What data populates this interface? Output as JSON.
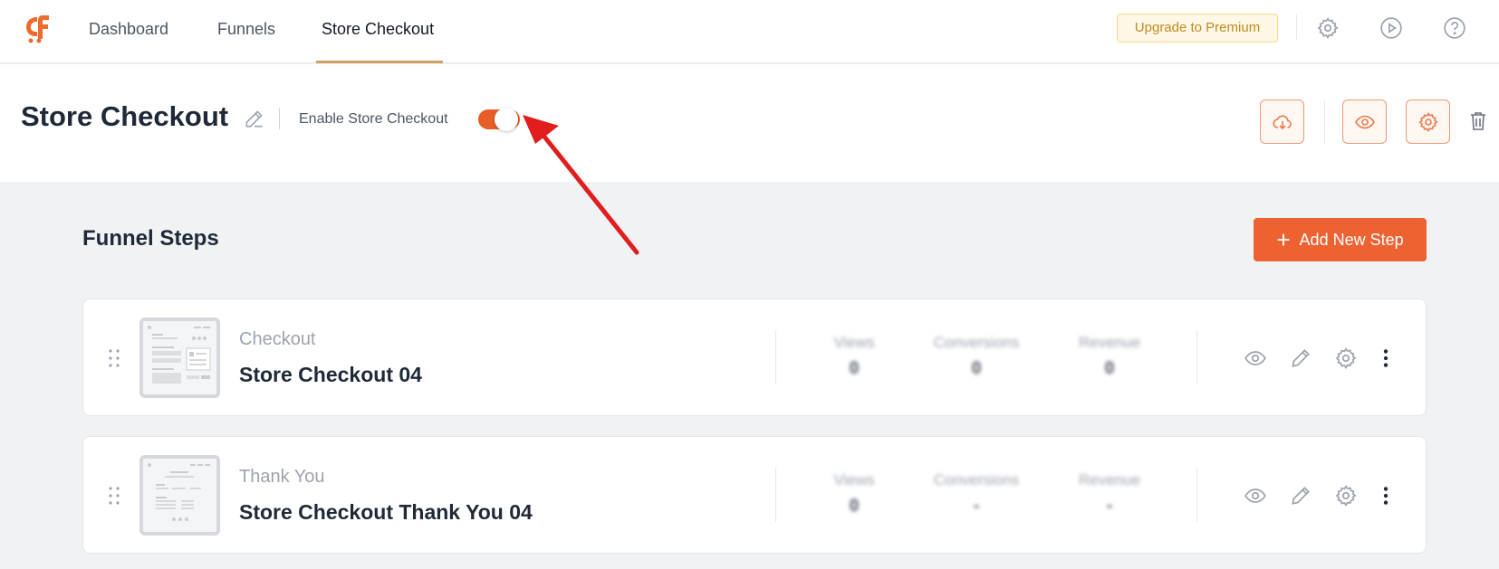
{
  "nav": {
    "links": [
      "Dashboard",
      "Funnels",
      "Store Checkout"
    ],
    "active_index": 2,
    "upgrade_label": "Upgrade to Premium"
  },
  "header": {
    "title": "Store Checkout",
    "enable_label": "Enable Store Checkout",
    "enabled": true
  },
  "section": {
    "title": "Funnel Steps",
    "add_button_label": "Add New Step"
  },
  "steps": [
    {
      "type": "Checkout",
      "name": "Store Checkout 04",
      "stats": [
        {
          "label": "Views",
          "value": "0"
        },
        {
          "label": "Conversions",
          "value": "0"
        },
        {
          "label": "Revenue",
          "value": "0"
        }
      ]
    },
    {
      "type": "Thank You",
      "name": "Store Checkout Thank You 04",
      "stats": [
        {
          "label": "Views",
          "value": "0"
        },
        {
          "label": "Conversions",
          "value": "-"
        },
        {
          "label": "Revenue",
          "value": "-"
        }
      ]
    }
  ],
  "colors": {
    "accent": "#ee6232",
    "toggle_on": "#e65e26",
    "annotation_arrow": "#e11d1d"
  }
}
